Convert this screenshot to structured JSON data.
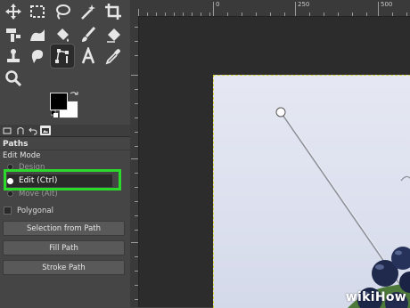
{
  "toolbox": {
    "tools": [
      {
        "icon": "move-tool-icon"
      },
      {
        "icon": "rect-select-icon"
      },
      {
        "icon": "lasso-select-icon"
      },
      {
        "icon": "fuzzy-select-icon"
      },
      {
        "icon": "crop-icon"
      },
      {
        "icon": "transform-icon"
      },
      {
        "icon": "warp-icon"
      },
      {
        "icon": "bucket-fill-icon"
      },
      {
        "icon": "paintbrush-icon"
      },
      {
        "icon": "eraser-icon"
      },
      {
        "icon": "clone-stamp-icon"
      },
      {
        "icon": "smudge-icon"
      },
      {
        "icon": "paths-tool-icon"
      },
      {
        "icon": "text-tool-icon"
      },
      {
        "icon": "color-picker-icon"
      },
      {
        "icon": "zoom-icon"
      }
    ],
    "active_tool": "paths-tool-icon",
    "fg_color": "#000000",
    "bg_color": "#ffffff"
  },
  "tool_options": {
    "title": "Paths",
    "edit_mode_label": "Edit Mode",
    "modes": [
      {
        "label": "Design",
        "checked": false
      },
      {
        "label": "Edit (Ctrl)",
        "checked": true
      },
      {
        "label": "Move (Alt)",
        "checked": false
      }
    ],
    "polygonal_label": "Polygonal",
    "polygonal_checked": false,
    "buttons": {
      "selection_from_path": "Selection from Path",
      "fill_path": "Fill Path",
      "stroke_path": "Stroke Path"
    },
    "highlight_color": "#2bd92b"
  },
  "canvas": {
    "ruler_labels": [
      "0",
      "250",
      "500"
    ],
    "watermark": "wikiHow"
  }
}
